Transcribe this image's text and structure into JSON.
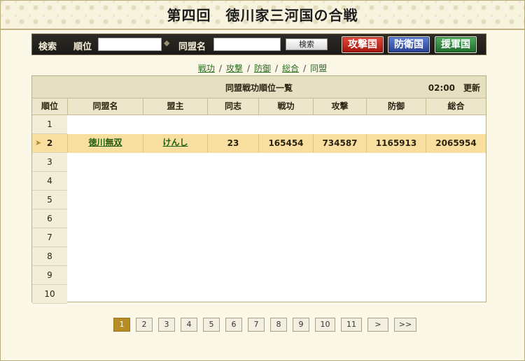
{
  "page": {
    "title": "第四回　徳川家三河国の合戦"
  },
  "search": {
    "label": "検索",
    "rank_label": "順位",
    "rank_value": "",
    "alliance_label": "同盟名",
    "alliance_value": "",
    "search_button": "検索",
    "nation_buttons": [
      "攻撃国",
      "防衛国",
      "援軍国"
    ]
  },
  "categories": {
    "items": [
      "戦功",
      "攻撃",
      "防御",
      "総合",
      "同盟"
    ],
    "current": "同盟"
  },
  "table": {
    "title": "同盟戦功順位一覧",
    "update_time": "02:00　更新",
    "columns": [
      "順位",
      "同盟名",
      "盟主",
      "同志",
      "戦功",
      "攻撃",
      "防御",
      "総合"
    ],
    "rows": [
      {
        "rank": "1"
      },
      {
        "rank": "2",
        "alliance": "徳川無双",
        "leader": "けんし",
        "members": "23",
        "merit": "165454",
        "attack": "734587",
        "defense": "1165913",
        "total": "2065954",
        "highlighted": true
      },
      {
        "rank": "3"
      },
      {
        "rank": "4"
      },
      {
        "rank": "5"
      },
      {
        "rank": "6"
      },
      {
        "rank": "7"
      },
      {
        "rank": "8"
      },
      {
        "rank": "9"
      },
      {
        "rank": "10"
      }
    ]
  },
  "pagination": {
    "pages": [
      "1",
      "2",
      "3",
      "4",
      "5",
      "6",
      "7",
      "8",
      "9",
      "10",
      "11"
    ],
    "current": "1",
    "next": ">",
    "last": ">>"
  },
  "colors": {
    "accent_gold": "#b68c25",
    "highlight_row": "#f8df9f",
    "attack_red": "#a3140e",
    "defend_blue": "#283f8f",
    "support_green": "#1e6a2a",
    "link_green": "#2b6b1d"
  }
}
